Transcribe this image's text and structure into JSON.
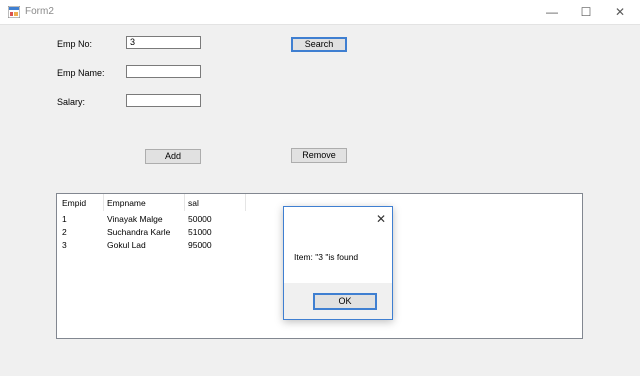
{
  "window": {
    "title": "Form2",
    "minimize": "—",
    "maximize": "☐",
    "close": "✕"
  },
  "form": {
    "emp_no_label": "Emp No:",
    "emp_no_value": "3",
    "emp_name_label": "Emp Name:",
    "emp_name_value": "",
    "salary_label": "Salary:",
    "salary_value": "",
    "search_label": "Search",
    "add_label": "Add",
    "remove_label": "Remove"
  },
  "list": {
    "columns": [
      "Empid",
      "Empname",
      "sal"
    ],
    "rows": [
      [
        "1",
        "Vinayak Malge",
        "50000"
      ],
      [
        "2",
        "Suchandra Karle",
        "51000"
      ],
      [
        "3",
        "Gokul Lad",
        "95000"
      ]
    ]
  },
  "dialog": {
    "close": "✕",
    "message": "Item: \"3 \"is found",
    "ok_label": "OK"
  },
  "colors": {
    "accent": "#3f7fd1",
    "window_bg": "#f0f0f0"
  }
}
